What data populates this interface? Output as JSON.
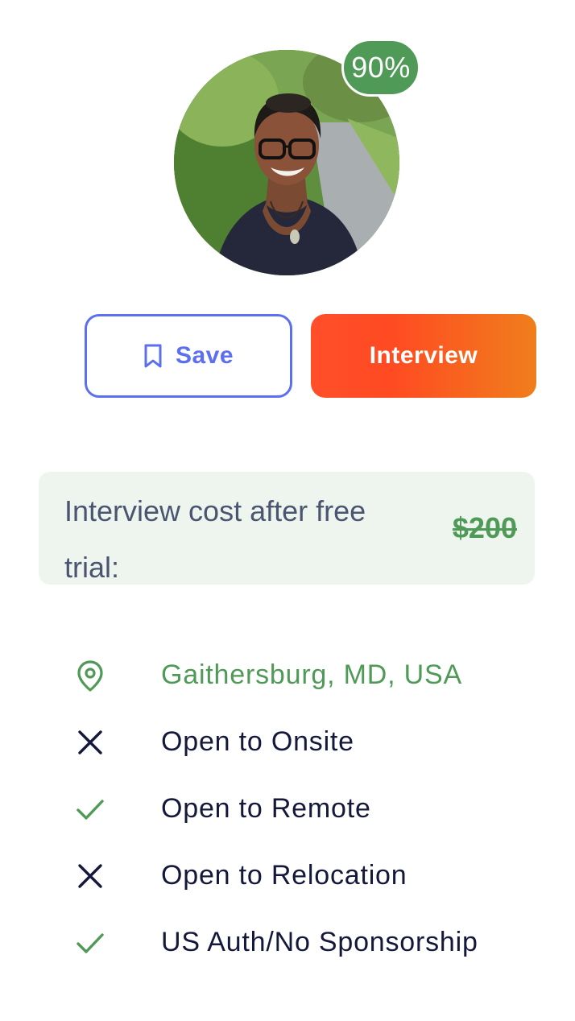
{
  "profile": {
    "match_percent": "90%",
    "avatar_alt": "candidate-photo"
  },
  "actions": {
    "save_label": "Save",
    "interview_label": "Interview"
  },
  "cost": {
    "label": "Interview cost after free trial:",
    "price": "$200",
    "price_struck_through": true
  },
  "details": {
    "location": "Gaithersburg, MD, USA",
    "onsite": "Open to Onsite",
    "remote": "Open to Remote",
    "relocation": "Open to Relocation",
    "work_auth": "US Auth/No Sponsorship"
  },
  "detail_icons": {
    "location": "map-pin-icon",
    "onsite": "x-icon",
    "remote": "check-icon",
    "relocation": "x-icon",
    "work_auth": "check-icon"
  },
  "colors": {
    "accent_blue": "#5b6ff0",
    "interview_gradient_start": "#ff4f2a",
    "interview_gradient_end": "#f07e1c",
    "success_green": "#4f9a57",
    "cost_bg": "#eef5ee",
    "text_dark": "#14183a"
  }
}
